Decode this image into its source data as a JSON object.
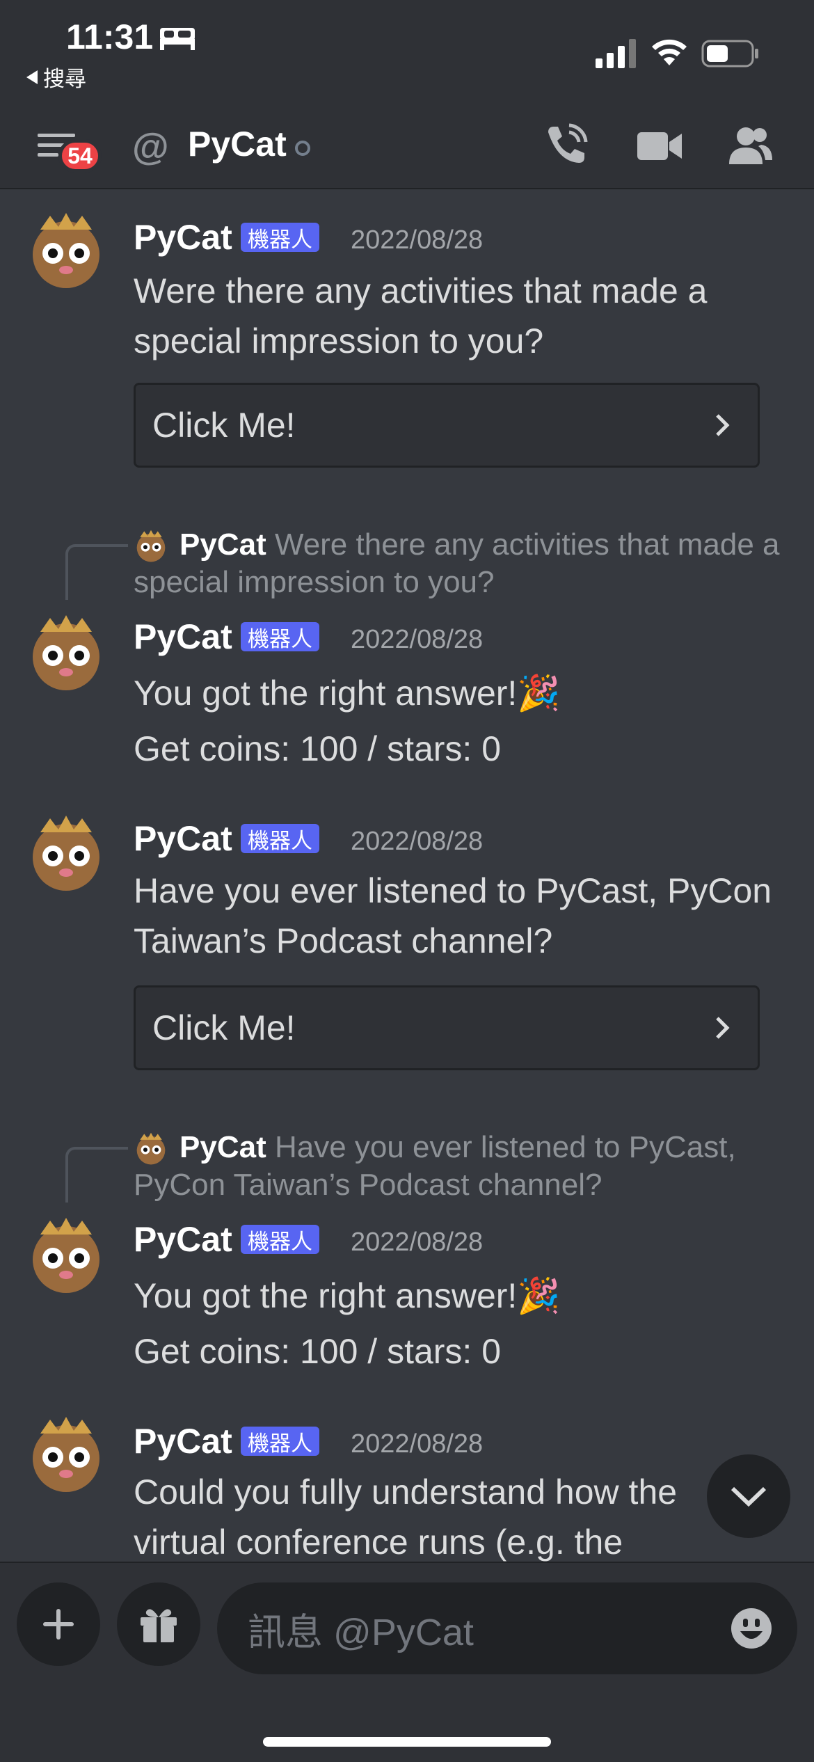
{
  "status_bar": {
    "time": "11:31",
    "back_label": "搜尋"
  },
  "header": {
    "badge_count": "54",
    "at_symbol": "@",
    "channel_name": "PyCat"
  },
  "messages": [
    {
      "author": "PyCat",
      "bot_tag": "機器人",
      "timestamp": "2022/08/28",
      "text": "Were there any activities that made a special impression to you?",
      "button_label": "Click Me!"
    },
    {
      "reply_author": "PyCat",
      "reply_text": "Were there any activities that made a special impression to you?",
      "author": "PyCat",
      "bot_tag": "機器人",
      "timestamp": "2022/08/28",
      "line1": "You got the right answer!🎉",
      "line2": "Get coins: 100 / stars: 0"
    },
    {
      "author": "PyCat",
      "bot_tag": "機器人",
      "timestamp": "2022/08/28",
      "text": "Have you ever listened to PyCast, PyCon Taiwan’s Podcast channel?",
      "button_label": "Click Me!"
    },
    {
      "reply_author": "PyCat",
      "reply_text": "Have you ever listened to PyCast, PyCon Taiwan’s Podcast channel?",
      "author": "PyCat",
      "bot_tag": "機器人",
      "timestamp": "2022/08/28",
      "line1": "You got the right answer!🎉",
      "line2": "Get coins: 100 / stars: 0"
    },
    {
      "author": "PyCat",
      "bot_tag": "機器人",
      "timestamp": "2022/08/28",
      "text": "Could you fully understand how the virtual conference runs (e.g. the"
    }
  ],
  "composer": {
    "placeholder": "訊息 @PyCat"
  },
  "colors": {
    "background": "#36393f",
    "header": "#2f3136",
    "blurple": "#5865f2",
    "badge": "#ed4245"
  }
}
